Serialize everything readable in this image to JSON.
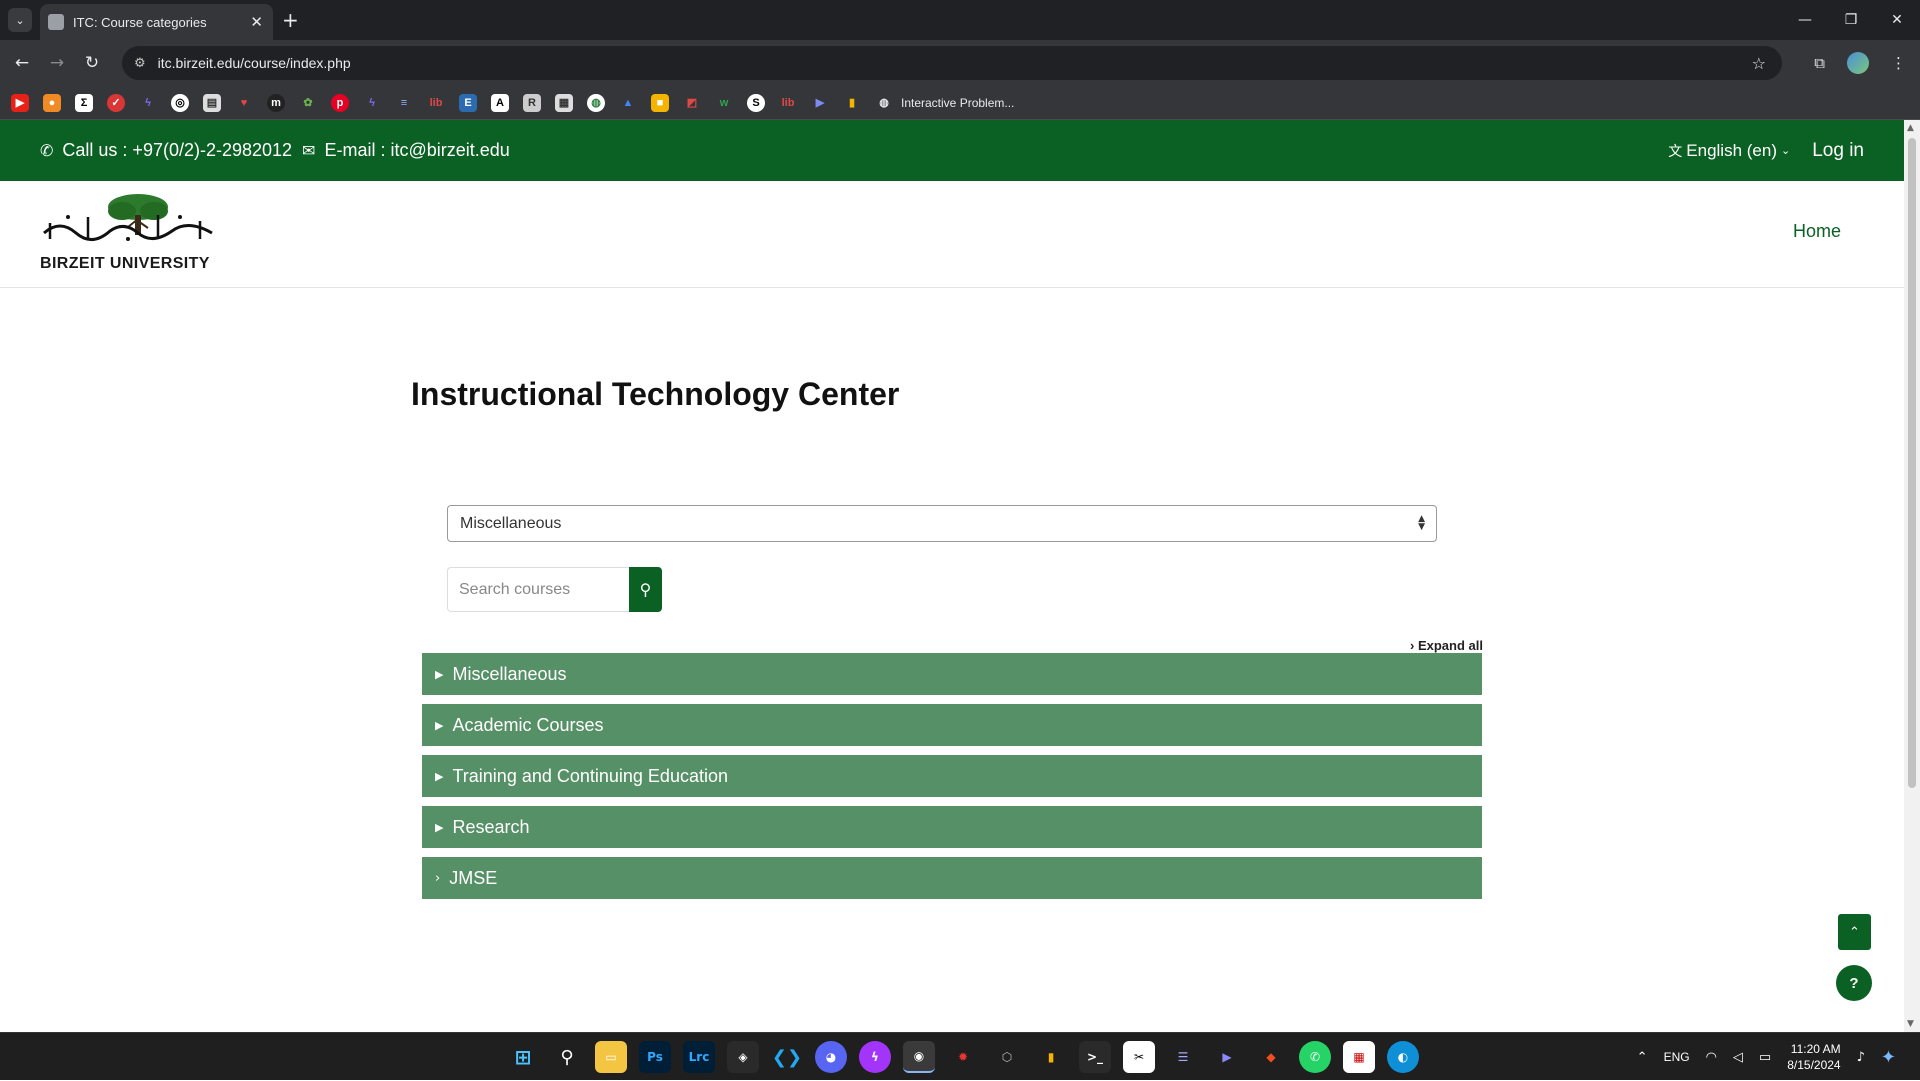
{
  "browser": {
    "tab_title": "ITC: Course categories",
    "url": "itc.birzeit.edu/course/index.php",
    "bookmark_label": "Interactive Problem..."
  },
  "topbar": {
    "phone": "Call us : +97(0/2)-2-2982012",
    "email": "E-mail : itc@birzeit.edu",
    "language": "English (en)",
    "login": "Log in"
  },
  "header": {
    "logo_text": "BIRZEIT UNIVERSITY",
    "home_link": "Home"
  },
  "main": {
    "title": "Instructional Technology Center",
    "category_select": "Miscellaneous",
    "search_placeholder": "Search courses",
    "expand_all": "Expand all",
    "categories": [
      {
        "label": "Miscellaneous"
      },
      {
        "label": "Academic Courses"
      },
      {
        "label": "Training and Continuing Education"
      },
      {
        "label": "Research"
      },
      {
        "label": "JMSE"
      }
    ]
  },
  "taskbar": {
    "lang": "ENG",
    "time": "11:20 AM",
    "date": "8/15/2024"
  },
  "colors": {
    "brand_green": "#0b6123",
    "category_green": "#569066"
  }
}
